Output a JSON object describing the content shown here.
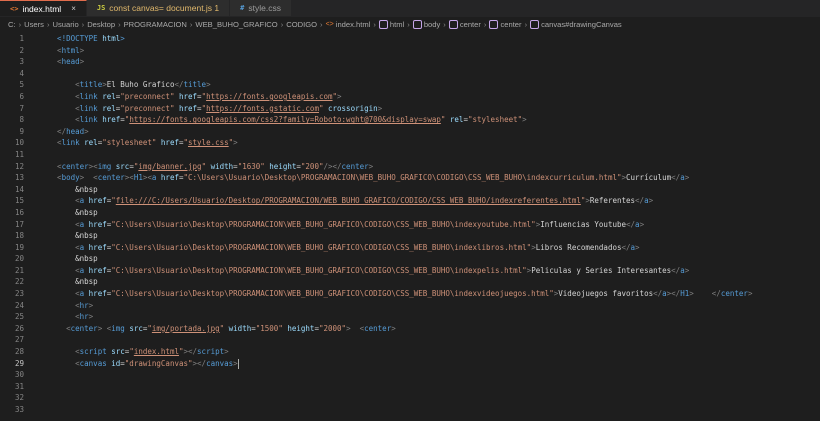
{
  "tabs": [
    {
      "icon": "html-file-icon",
      "glyph": "<>",
      "label": "index.html",
      "active": true,
      "close": "×"
    },
    {
      "icon": "js-file-icon",
      "glyph": "JS",
      "label": "const canvas= document.js 1",
      "active": false
    },
    {
      "icon": "css-file-icon",
      "glyph": "#",
      "label": "style.css",
      "active": false
    }
  ],
  "breadcrumbs": [
    "C:",
    "Users",
    "Usuario",
    "Desktop",
    "PROGRAMACION",
    "WEB_BUHO_GRAFICO",
    "CODIGO",
    "index.html",
    "html",
    "body",
    "center",
    "center",
    "canvas#drawingCanvas"
  ],
  "editor": {
    "current_line": 29,
    "lines": [
      {
        "n": "1",
        "tokens": [
          {
            "c": "t",
            "v": "    <!DOCTYPE "
          },
          {
            "c": "a",
            "v": "html"
          },
          {
            "c": "t",
            "v": ">"
          }
        ]
      },
      {
        "n": "2",
        "tokens": [
          {
            "c": "b",
            "v": "    <"
          },
          {
            "c": "t",
            "v": "html"
          },
          {
            "c": "b",
            "v": ">"
          }
        ]
      },
      {
        "n": "3",
        "tokens": [
          {
            "c": "b",
            "v": "    <"
          },
          {
            "c": "t",
            "v": "head"
          },
          {
            "c": "b",
            "v": ">"
          }
        ]
      },
      {
        "n": "4",
        "tokens": []
      },
      {
        "n": "5",
        "tokens": [
          {
            "c": "b",
            "v": "        <"
          },
          {
            "c": "t",
            "v": "title"
          },
          {
            "c": "b",
            "v": ">"
          },
          {
            "c": "x",
            "v": "El Buho Grafico"
          },
          {
            "c": "b",
            "v": "</"
          },
          {
            "c": "t",
            "v": "title"
          },
          {
            "c": "b",
            "v": ">"
          }
        ]
      },
      {
        "n": "6",
        "tokens": [
          {
            "c": "b",
            "v": "        <"
          },
          {
            "c": "t",
            "v": "link "
          },
          {
            "c": "a",
            "v": "rel"
          },
          {
            "c": "x",
            "v": "="
          },
          {
            "c": "s",
            "v": "\"preconnect\" "
          },
          {
            "c": "a",
            "v": "href"
          },
          {
            "c": "x",
            "v": "="
          },
          {
            "c": "s",
            "v": "\""
          },
          {
            "c": "u",
            "v": "https://fonts.googleapis.com"
          },
          {
            "c": "s",
            "v": "\""
          },
          {
            "c": "b",
            "v": ">"
          }
        ]
      },
      {
        "n": "7",
        "tokens": [
          {
            "c": "b",
            "v": "        <"
          },
          {
            "c": "t",
            "v": "link "
          },
          {
            "c": "a",
            "v": "rel"
          },
          {
            "c": "x",
            "v": "="
          },
          {
            "c": "s",
            "v": "\"preconnect\" "
          },
          {
            "c": "a",
            "v": "href"
          },
          {
            "c": "x",
            "v": "="
          },
          {
            "c": "s",
            "v": "\""
          },
          {
            "c": "u",
            "v": "https://fonts.gstatic.com"
          },
          {
            "c": "s",
            "v": "\" "
          },
          {
            "c": "a",
            "v": "crossorigin"
          },
          {
            "c": "b",
            "v": ">"
          }
        ]
      },
      {
        "n": "8",
        "tokens": [
          {
            "c": "b",
            "v": "        <"
          },
          {
            "c": "t",
            "v": "link "
          },
          {
            "c": "a",
            "v": "href"
          },
          {
            "c": "x",
            "v": "="
          },
          {
            "c": "s",
            "v": "\""
          },
          {
            "c": "u",
            "v": "https://fonts.googleapis.com/css2?family=Roboto:wght@700&display=swap"
          },
          {
            "c": "s",
            "v": "\" "
          },
          {
            "c": "a",
            "v": "rel"
          },
          {
            "c": "x",
            "v": "="
          },
          {
            "c": "s",
            "v": "\"stylesheet\""
          },
          {
            "c": "b",
            "v": ">"
          }
        ]
      },
      {
        "n": "9",
        "tokens": [
          {
            "c": "b",
            "v": "    </"
          },
          {
            "c": "t",
            "v": "head"
          },
          {
            "c": "b",
            "v": ">"
          }
        ]
      },
      {
        "n": "10",
        "tokens": [
          {
            "c": "b",
            "v": "    <"
          },
          {
            "c": "t",
            "v": "link "
          },
          {
            "c": "a",
            "v": "rel"
          },
          {
            "c": "x",
            "v": "="
          },
          {
            "c": "s",
            "v": "\"stylesheet\" "
          },
          {
            "c": "a",
            "v": "href"
          },
          {
            "c": "x",
            "v": "="
          },
          {
            "c": "s",
            "v": "\""
          },
          {
            "c": "u",
            "v": "style.css"
          },
          {
            "c": "s",
            "v": "\""
          },
          {
            "c": "b",
            "v": ">"
          }
        ]
      },
      {
        "n": "11",
        "tokens": []
      },
      {
        "n": "12",
        "tokens": [
          {
            "c": "b",
            "v": "    <"
          },
          {
            "c": "t",
            "v": "center"
          },
          {
            "c": "b",
            "v": "><"
          },
          {
            "c": "t",
            "v": "img "
          },
          {
            "c": "a",
            "v": "src"
          },
          {
            "c": "x",
            "v": "="
          },
          {
            "c": "s",
            "v": "\""
          },
          {
            "c": "u",
            "v": "img/banner.jpg"
          },
          {
            "c": "s",
            "v": "\" "
          },
          {
            "c": "a",
            "v": "width"
          },
          {
            "c": "x",
            "v": "="
          },
          {
            "c": "s",
            "v": "\"1630\" "
          },
          {
            "c": "a",
            "v": "height"
          },
          {
            "c": "x",
            "v": "="
          },
          {
            "c": "s",
            "v": "\"200\""
          },
          {
            "c": "b",
            "v": "/></"
          },
          {
            "c": "t",
            "v": "center"
          },
          {
            "c": "b",
            "v": ">"
          }
        ]
      },
      {
        "n": "13",
        "tokens": [
          {
            "c": "b",
            "v": "    <"
          },
          {
            "c": "t",
            "v": "body"
          },
          {
            "c": "b",
            "v": ">  <"
          },
          {
            "c": "t",
            "v": "center"
          },
          {
            "c": "b",
            "v": "><"
          },
          {
            "c": "t",
            "v": "H1"
          },
          {
            "c": "b",
            "v": "><"
          },
          {
            "c": "t",
            "v": "a "
          },
          {
            "c": "a",
            "v": "href"
          },
          {
            "c": "x",
            "v": "="
          },
          {
            "c": "s",
            "v": "\"C:\\Users\\Usuario\\Desktop\\PROGRAMACION\\WEB_BUHO_GRAFICO\\CODIGO\\CSS_WEB_BUHO\\indexcurriculum.html\""
          },
          {
            "c": "b",
            "v": ">"
          },
          {
            "c": "x",
            "v": "Currículum"
          },
          {
            "c": "b",
            "v": "</"
          },
          {
            "c": "t",
            "v": "a"
          },
          {
            "c": "b",
            "v": ">"
          }
        ]
      },
      {
        "n": "14",
        "tokens": [
          {
            "c": "x",
            "v": "        &nbsp"
          }
        ]
      },
      {
        "n": "15",
        "tokens": [
          {
            "c": "b",
            "v": "        <"
          },
          {
            "c": "t",
            "v": "a "
          },
          {
            "c": "a",
            "v": "href"
          },
          {
            "c": "x",
            "v": "="
          },
          {
            "c": "s",
            "v": "\""
          },
          {
            "c": "u",
            "v": "file:///C:/Users/Usuario/Desktop/PROGRAMACION/WEB_BUHO_GRAFICO/CODIGO/CSS_WEB_BUHO/indexreferentes.html"
          },
          {
            "c": "s",
            "v": "\""
          },
          {
            "c": "b",
            "v": ">"
          },
          {
            "c": "x",
            "v": "Referentes"
          },
          {
            "c": "b",
            "v": "</"
          },
          {
            "c": "t",
            "v": "a"
          },
          {
            "c": "b",
            "v": ">"
          }
        ]
      },
      {
        "n": "16",
        "tokens": [
          {
            "c": "x",
            "v": "        &nbsp"
          }
        ]
      },
      {
        "n": "17",
        "tokens": [
          {
            "c": "b",
            "v": "        <"
          },
          {
            "c": "t",
            "v": "a "
          },
          {
            "c": "a",
            "v": "href"
          },
          {
            "c": "x",
            "v": "="
          },
          {
            "c": "s",
            "v": "\"C:\\Users\\Usuario\\Desktop\\PROGRAMACION\\WEB_BUHO_GRAFICO\\CODIGO\\CSS_WEB_BUHO\\indexyoutube.html\""
          },
          {
            "c": "b",
            "v": ">"
          },
          {
            "c": "x",
            "v": "Influencias Youtube"
          },
          {
            "c": "b",
            "v": "</"
          },
          {
            "c": "t",
            "v": "a"
          },
          {
            "c": "b",
            "v": ">"
          }
        ]
      },
      {
        "n": "18",
        "tokens": [
          {
            "c": "x",
            "v": "        &nbsp"
          }
        ]
      },
      {
        "n": "19",
        "tokens": [
          {
            "c": "b",
            "v": "        <"
          },
          {
            "c": "t",
            "v": "a "
          },
          {
            "c": "a",
            "v": "href"
          },
          {
            "c": "x",
            "v": "="
          },
          {
            "c": "s",
            "v": "\"C:\\Users\\Usuario\\Desktop\\PROGRAMACION\\WEB_BUHO_GRAFICO\\CODIGO\\CSS_WEB_BUHO\\indexlibros.html\""
          },
          {
            "c": "b",
            "v": ">"
          },
          {
            "c": "x",
            "v": "Libros Recomendados"
          },
          {
            "c": "b",
            "v": "</"
          },
          {
            "c": "t",
            "v": "a"
          },
          {
            "c": "b",
            "v": ">"
          }
        ]
      },
      {
        "n": "20",
        "tokens": [
          {
            "c": "x",
            "v": "        &nbsp"
          }
        ]
      },
      {
        "n": "21",
        "tokens": [
          {
            "c": "b",
            "v": "        <"
          },
          {
            "c": "t",
            "v": "a "
          },
          {
            "c": "a",
            "v": "href"
          },
          {
            "c": "x",
            "v": "="
          },
          {
            "c": "s",
            "v": "\"C:\\Users\\Usuario\\Desktop\\PROGRAMACION\\WEB_BUHO_GRAFICO\\CODIGO\\CSS_WEB_BUHO\\indexpelis.html\""
          },
          {
            "c": "b",
            "v": ">"
          },
          {
            "c": "x",
            "v": "Peliculas y Series Interesantes"
          },
          {
            "c": "b",
            "v": "</"
          },
          {
            "c": "t",
            "v": "a"
          },
          {
            "c": "b",
            "v": ">"
          }
        ]
      },
      {
        "n": "22",
        "tokens": [
          {
            "c": "x",
            "v": "        &nbsp"
          }
        ]
      },
      {
        "n": "23",
        "tokens": [
          {
            "c": "b",
            "v": "        <"
          },
          {
            "c": "t",
            "v": "a "
          },
          {
            "c": "a",
            "v": "href"
          },
          {
            "c": "x",
            "v": "="
          },
          {
            "c": "s",
            "v": "\"C:\\Users\\Usuario\\Desktop\\PROGRAMACION\\WEB_BUHO_GRAFICO\\CODIGO\\CSS_WEB_BUHO\\indexvideojuegos.html\""
          },
          {
            "c": "b",
            "v": ">"
          },
          {
            "c": "x",
            "v": "Videojuegos favoritos"
          },
          {
            "c": "b",
            "v": "</"
          },
          {
            "c": "t",
            "v": "a"
          },
          {
            "c": "b",
            "v": "></"
          },
          {
            "c": "t",
            "v": "H1"
          },
          {
            "c": "b",
            "v": ">    </"
          },
          {
            "c": "t",
            "v": "center"
          },
          {
            "c": "b",
            "v": ">"
          }
        ]
      },
      {
        "n": "24",
        "tokens": [
          {
            "c": "b",
            "v": "        <"
          },
          {
            "c": "t",
            "v": "hr"
          },
          {
            "c": "b",
            "v": ">"
          }
        ]
      },
      {
        "n": "25",
        "tokens": [
          {
            "c": "b",
            "v": "        <"
          },
          {
            "c": "t",
            "v": "hr"
          },
          {
            "c": "b",
            "v": ">"
          }
        ]
      },
      {
        "n": "26",
        "tokens": [
          {
            "c": "b",
            "v": "      <"
          },
          {
            "c": "t",
            "v": "center"
          },
          {
            "c": "b",
            "v": "> <"
          },
          {
            "c": "t",
            "v": "img "
          },
          {
            "c": "a",
            "v": "src"
          },
          {
            "c": "x",
            "v": "="
          },
          {
            "c": "s",
            "v": "\""
          },
          {
            "c": "u",
            "v": "img/portada.jpg"
          },
          {
            "c": "s",
            "v": "\" "
          },
          {
            "c": "a",
            "v": "width"
          },
          {
            "c": "x",
            "v": "="
          },
          {
            "c": "s",
            "v": "\"1500\" "
          },
          {
            "c": "a",
            "v": "height"
          },
          {
            "c": "x",
            "v": "="
          },
          {
            "c": "s",
            "v": "\"2000\""
          },
          {
            "c": "b",
            "v": ">  <"
          },
          {
            "c": "t",
            "v": "center"
          },
          {
            "c": "b",
            "v": ">"
          }
        ]
      },
      {
        "n": "27",
        "tokens": []
      },
      {
        "n": "28",
        "tokens": [
          {
            "c": "b",
            "v": "        <"
          },
          {
            "c": "t",
            "v": "script "
          },
          {
            "c": "a",
            "v": "src"
          },
          {
            "c": "x",
            "v": "="
          },
          {
            "c": "s",
            "v": "\""
          },
          {
            "c": "u",
            "v": "index.html"
          },
          {
            "c": "s",
            "v": "\""
          },
          {
            "c": "b",
            "v": "></"
          },
          {
            "c": "t",
            "v": "script"
          },
          {
            "c": "b",
            "v": ">"
          }
        ]
      },
      {
        "n": "29",
        "tokens": [
          {
            "c": "b",
            "v": "        <"
          },
          {
            "c": "t",
            "v": "canvas "
          },
          {
            "c": "a",
            "v": "id"
          },
          {
            "c": "x",
            "v": "="
          },
          {
            "c": "s",
            "v": "\"drawingCanvas\""
          },
          {
            "c": "b",
            "v": "></"
          },
          {
            "c": "t",
            "v": "canvas"
          },
          {
            "c": "b",
            "v": ">"
          }
        ]
      },
      {
        "n": "30",
        "tokens": []
      },
      {
        "n": "31",
        "tokens": []
      },
      {
        "n": "32",
        "tokens": []
      },
      {
        "n": "33",
        "tokens": []
      }
    ]
  }
}
